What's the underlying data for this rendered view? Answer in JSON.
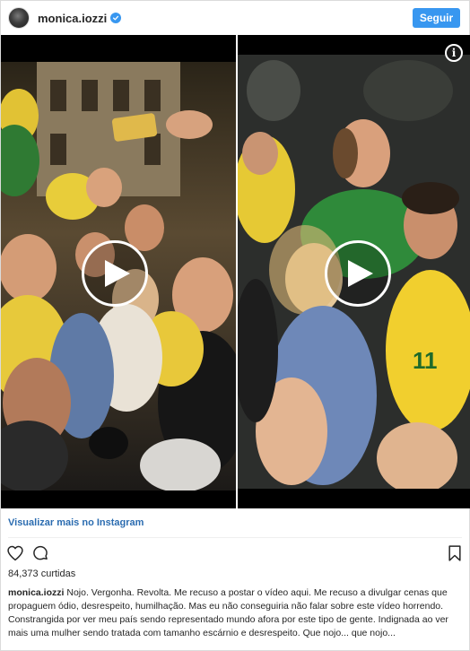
{
  "header": {
    "username": "monica.iozzi",
    "follow_label": "Seguir"
  },
  "media": {
    "left_video": {
      "play_icon": "play-icon"
    },
    "right_video": {
      "play_icon": "play-icon",
      "info_icon": "info-icon",
      "info_glyph": "i"
    }
  },
  "view_more_label": "Visualizar mais no Instagram",
  "actions": {
    "like_icon": "heart-icon",
    "comment_icon": "comment-icon",
    "save_icon": "bookmark-icon"
  },
  "likes_text": "84,373 curtidas",
  "caption": {
    "username": "monica.iozzi",
    "text": " Nojo. Vergonha. Revolta. Me recuso a postar o vídeo aqui. Me recuso a divulgar cenas que propaguem ódio, desrespeito, humilhação. Mas eu não conseguiria não falar sobre este vídeo horrendo. Constrangida por ver meu país sendo representado mundo afora por este tipo de gente. Indignada ao ver mais uma mulher sendo tratada com tamanho escárnio e desrespeito. Que nojo... que nojo..."
  },
  "colors": {
    "accent": "#3897f0",
    "link": "#2b6cb0",
    "text": "#262626"
  }
}
